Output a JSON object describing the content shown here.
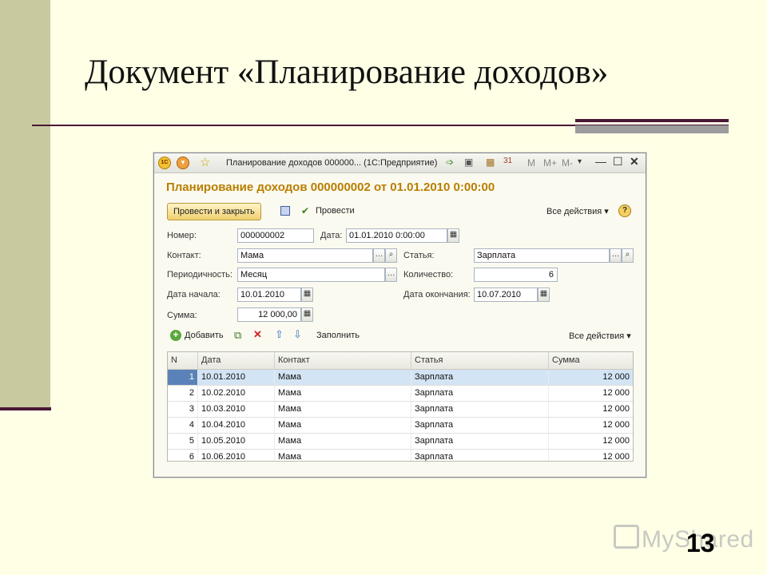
{
  "slide": {
    "title": "Документ «Планирование доходов»",
    "number": "13",
    "watermark": "MyShared"
  },
  "window": {
    "title": "Планирование доходов 000000... (1С:Предприятие)",
    "m_buttons": [
      "M",
      "M+",
      "M-"
    ],
    "logo_text": "1С"
  },
  "document": {
    "title": "Планирование доходов 000000002 от 01.01.2010 0:00:00",
    "toolbar": {
      "post_close_label": "Провести и закрыть",
      "post_label": "Провести",
      "all_actions_label": "Все действия ▾",
      "help_label": "?"
    },
    "fields": {
      "number_label": "Номер:",
      "number_value": "000000002",
      "date_label": "Дата:",
      "date_value": "01.01.2010 0:00:00",
      "contact_label": "Контакт:",
      "contact_value": "Мама",
      "article_label": "Статья:",
      "article_value": "Зарплата",
      "period_label": "Периодичность:",
      "period_value": "Месяц",
      "qty_label": "Количество:",
      "qty_value": "6",
      "start_label": "Дата начала:",
      "start_value": "10.01.2010",
      "end_label": "Дата окончания:",
      "end_value": "10.07.2010",
      "sum_label": "Сумма:",
      "sum_value": "12 000,00"
    },
    "table_toolbar": {
      "add_label": "Добавить",
      "fill_label": "Заполнить",
      "all_actions_label": "Все действия ▾"
    },
    "table": {
      "columns": [
        "N",
        "Дата",
        "Контакт",
        "Статья",
        "Сумма"
      ],
      "rows": [
        [
          "1",
          "10.01.2010",
          "Мама",
          "Зарплата",
          "12 000"
        ],
        [
          "2",
          "10.02.2010",
          "Мама",
          "Зарплата",
          "12 000"
        ],
        [
          "3",
          "10.03.2010",
          "Мама",
          "Зарплата",
          "12 000"
        ],
        [
          "4",
          "10.04.2010",
          "Мама",
          "Зарплата",
          "12 000"
        ],
        [
          "5",
          "10.05.2010",
          "Мама",
          "Зарплата",
          "12 000"
        ],
        [
          "6",
          "10.06.2010",
          "Мама",
          "Зарплата",
          "12 000"
        ]
      ],
      "selected_row": 0
    }
  },
  "colors": {
    "accent_title": "#b87e00",
    "selection": "#d3e4f4",
    "slide_bg": "#ffffe6",
    "sidebar": "#c9c9a0",
    "rule": "#4a1836"
  }
}
